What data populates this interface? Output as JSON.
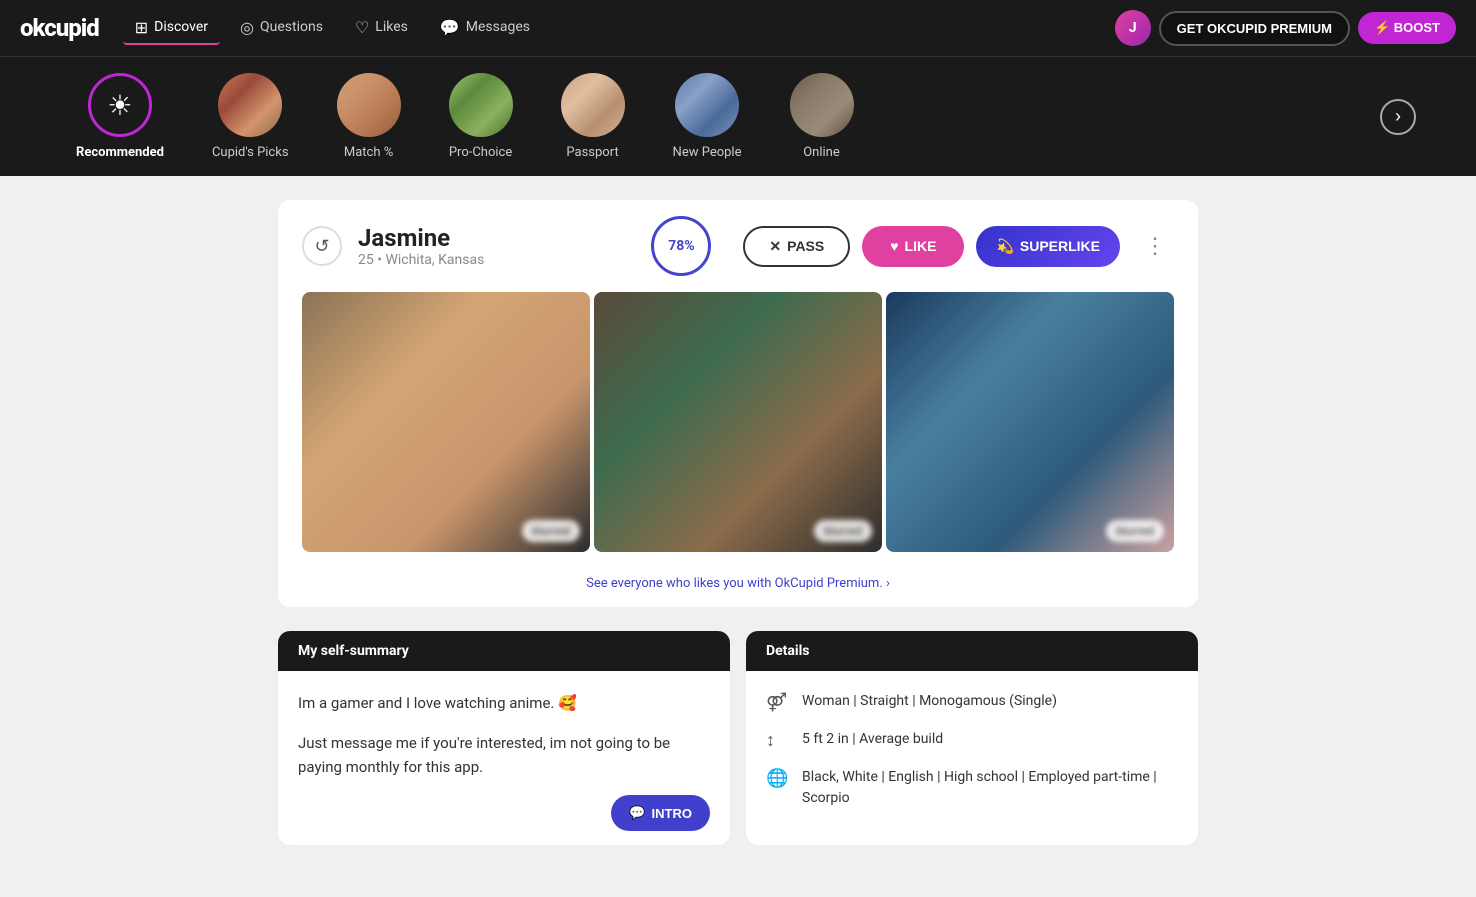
{
  "app": {
    "logo": "okcupid"
  },
  "nav": {
    "items": [
      {
        "id": "discover",
        "label": "Discover",
        "icon": "⊞",
        "active": true
      },
      {
        "id": "questions",
        "label": "Questions",
        "icon": "◎"
      },
      {
        "id": "likes",
        "label": "Likes",
        "icon": "♡"
      },
      {
        "id": "messages",
        "label": "Messages",
        "icon": "💬"
      }
    ],
    "premium_label": "GET OKCUPID PREMIUM",
    "boost_label": "⚡ BOOST"
  },
  "categories": [
    {
      "id": "recommended",
      "label": "Recommended",
      "active": true,
      "type": "icon"
    },
    {
      "id": "cupids-picks",
      "label": "Cupid's Picks",
      "active": false,
      "type": "photo"
    },
    {
      "id": "match",
      "label": "Match %",
      "active": false,
      "type": "photo"
    },
    {
      "id": "pro-choice",
      "label": "Pro-Choice",
      "active": false,
      "type": "photo"
    },
    {
      "id": "passport",
      "label": "Passport",
      "active": false,
      "type": "photo"
    },
    {
      "id": "new-people",
      "label": "New People",
      "active": false,
      "type": "photo"
    },
    {
      "id": "online",
      "label": "Online",
      "active": false,
      "type": "photo"
    }
  ],
  "profile": {
    "name": "Jasmine",
    "age": "25",
    "location": "Wichita, Kansas",
    "match_percent": "78%",
    "actions": {
      "pass": "PASS",
      "like": "LIKE",
      "superlike": "SUPERLIKE"
    },
    "premium_link": "See everyone who likes you with OkCupid Premium. ›",
    "self_summary_header": "My self-summary",
    "self_summary_line1": "Im a gamer and I love watching anime. 🥰",
    "self_summary_line2": "Just message me if you're interested, im not going to be paying monthly for this app.",
    "intro_label": "INTRO",
    "details_header": "Details",
    "details": [
      {
        "id": "orientation",
        "icon": "⚤",
        "text": "Woman | Straight | Monogamous (Single)"
      },
      {
        "id": "height",
        "icon": "↕",
        "text": "5 ft 2 in | Average build"
      },
      {
        "id": "ethnicity",
        "icon": "🌐",
        "text": "Black, White | English | High school | Employed part-time | Scorpio"
      }
    ]
  }
}
